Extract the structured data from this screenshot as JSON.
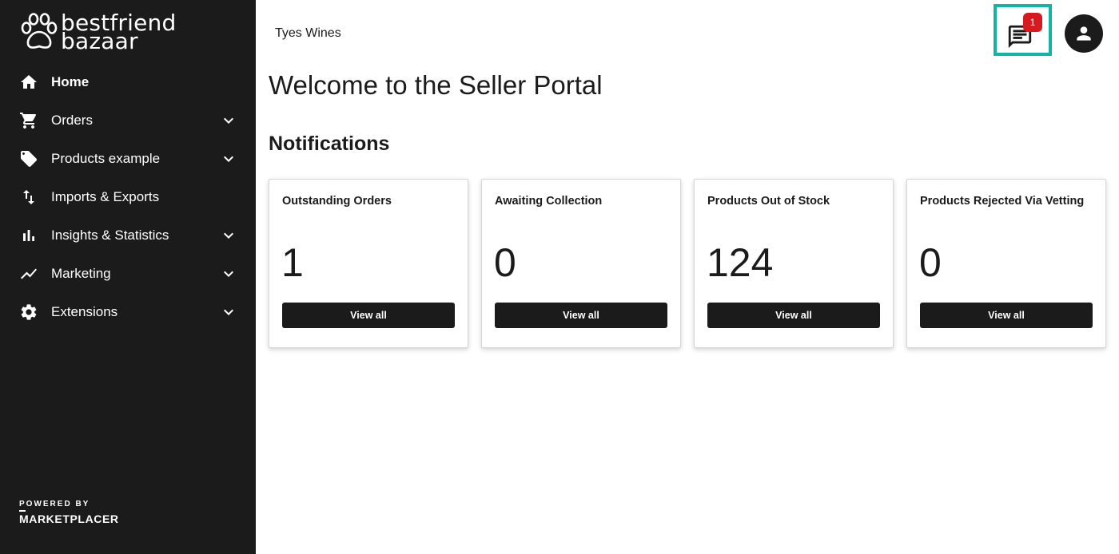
{
  "logo": {
    "line1": "bestfriend",
    "line2": "bazaar",
    "icon": "paw-icon"
  },
  "sidebar": {
    "items": [
      {
        "label": "Home",
        "icon": "home-icon",
        "active": true,
        "expandable": false
      },
      {
        "label": "Orders",
        "icon": "cart-icon",
        "active": false,
        "expandable": true
      },
      {
        "label": "Products example",
        "icon": "tag-icon",
        "active": false,
        "expandable": true
      },
      {
        "label": "Imports & Exports",
        "icon": "import-export-icon",
        "active": false,
        "expandable": false
      },
      {
        "label": "Insights & Statistics",
        "icon": "bar-chart-icon",
        "active": false,
        "expandable": true
      },
      {
        "label": "Marketing",
        "icon": "trending-icon",
        "active": false,
        "expandable": true
      },
      {
        "label": "Extensions",
        "icon": "gear-icon",
        "active": false,
        "expandable": true
      }
    ],
    "powered_by": "POWERED BY",
    "brand": "MARKETPLACER"
  },
  "header": {
    "store_name": "Tyes Wines",
    "messages_badge": "1",
    "highlight_color": "#14b3a4",
    "badge_color": "#d71920"
  },
  "main": {
    "title": "Welcome to the Seller Portal",
    "section_title": "Notifications",
    "cards": [
      {
        "title": "Outstanding Orders",
        "value": "1",
        "button": "View all"
      },
      {
        "title": "Awaiting Collection",
        "value": "0",
        "button": "View all"
      },
      {
        "title": "Products Out of Stock",
        "value": "124",
        "button": "View all"
      },
      {
        "title": "Products Rejected Via Vetting",
        "value": "0",
        "button": "View all"
      }
    ]
  },
  "colors": {
    "sidebar_bg": "#1b1b1b",
    "text": "#1b1b1b",
    "button_bg": "#1b1b1b"
  }
}
